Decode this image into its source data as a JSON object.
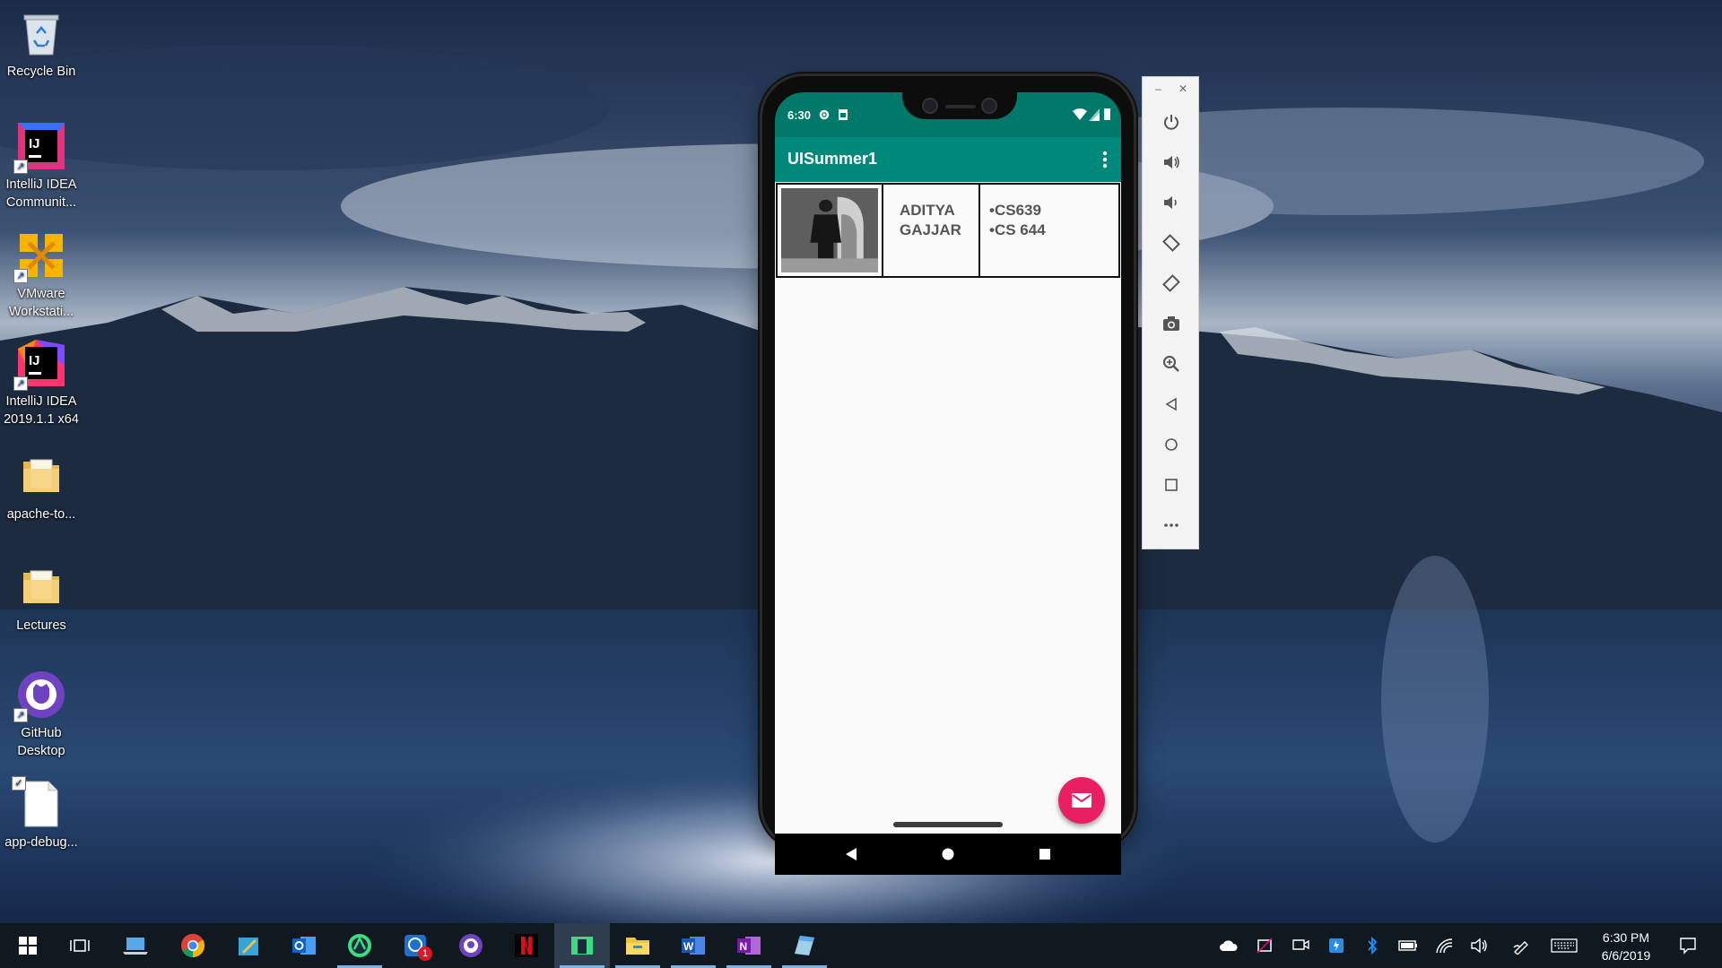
{
  "desktop": {
    "icons": [
      {
        "label": "Recycle Bin"
      },
      {
        "label": "IntelliJ IDEA Communit..."
      },
      {
        "label": "VMware Workstati..."
      },
      {
        "label": "IntelliJ IDEA 2019.1.1 x64"
      },
      {
        "label": "apache-to..."
      },
      {
        "label": "Lectures"
      },
      {
        "label": "GitHub Desktop"
      },
      {
        "label": "app-debug..."
      }
    ]
  },
  "phone": {
    "status_time": "6:30",
    "app_title": "UISummer1",
    "profile": {
      "name_line1": "ADITYA",
      "name_line2": "GAJJAR",
      "course1": "•CS639",
      "course2": "•CS 644"
    }
  },
  "taskbar": {
    "badge_count": "1",
    "clock_time": "6:30 PM",
    "clock_date": "6/6/2019"
  },
  "colors": {
    "status_bar": "#00796b",
    "app_bar": "#00897b",
    "fab": "#e91e63"
  }
}
